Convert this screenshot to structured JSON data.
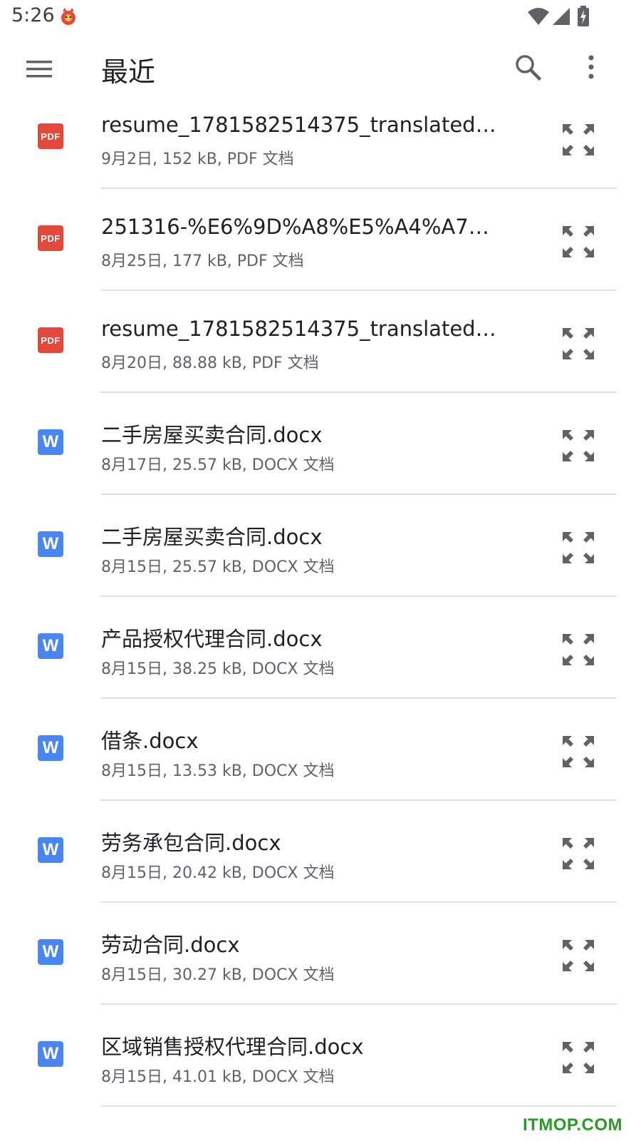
{
  "status_bar": {
    "time": "5:26",
    "icons": [
      "app-notification-icon",
      "wifi-icon",
      "cell-signal-icon",
      "battery-charging-icon"
    ]
  },
  "app_bar": {
    "title": "最近",
    "icons": [
      "menu-icon",
      "search-icon",
      "more-vert-icon"
    ]
  },
  "files": [
    {
      "type": "pdf",
      "badge": "PDF",
      "name": "resume_1781582514375_translated_1…",
      "meta": "9月2日, 152 kB, PDF 文档"
    },
    {
      "type": "pdf",
      "badge": "PDF",
      "name": "251316-%E6%9D%A8%E5%A4%A7%E8…",
      "meta": "8月25日, 177 kB, PDF 文档"
    },
    {
      "type": "pdf",
      "badge": "PDF",
      "name": "resume_1781582514375_translated_1…",
      "meta": "8月20日, 88.88 kB, PDF 文档"
    },
    {
      "type": "doc",
      "badge": "W",
      "name": "二手房屋买卖合同.docx",
      "meta": "8月17日, 25.57 kB, DOCX 文档"
    },
    {
      "type": "doc",
      "badge": "W",
      "name": "二手房屋买卖合同.docx",
      "meta": "8月15日, 25.57 kB, DOCX 文档"
    },
    {
      "type": "doc",
      "badge": "W",
      "name": "产品授权代理合同.docx",
      "meta": "8月15日, 38.25 kB, DOCX 文档"
    },
    {
      "type": "doc",
      "badge": "W",
      "name": "借条.docx",
      "meta": "8月15日, 13.53 kB, DOCX 文档"
    },
    {
      "type": "doc",
      "badge": "W",
      "name": "劳务承包合同.docx",
      "meta": "8月15日, 20.42 kB, DOCX 文档"
    },
    {
      "type": "doc",
      "badge": "W",
      "name": "劳动合同.docx",
      "meta": "8月15日, 30.27 kB, DOCX 文档"
    },
    {
      "type": "doc",
      "badge": "W",
      "name": "区域销售授权代理合同.docx",
      "meta": "8月15日, 41.01 kB, DOCX 文档"
    }
  ],
  "row_icon": "expand-icon",
  "colors": {
    "pdf_badge": "#e2493b",
    "doc_badge": "#4a86f0",
    "watermark": "#2b9a2b"
  },
  "watermark": "ITMOP.COM"
}
